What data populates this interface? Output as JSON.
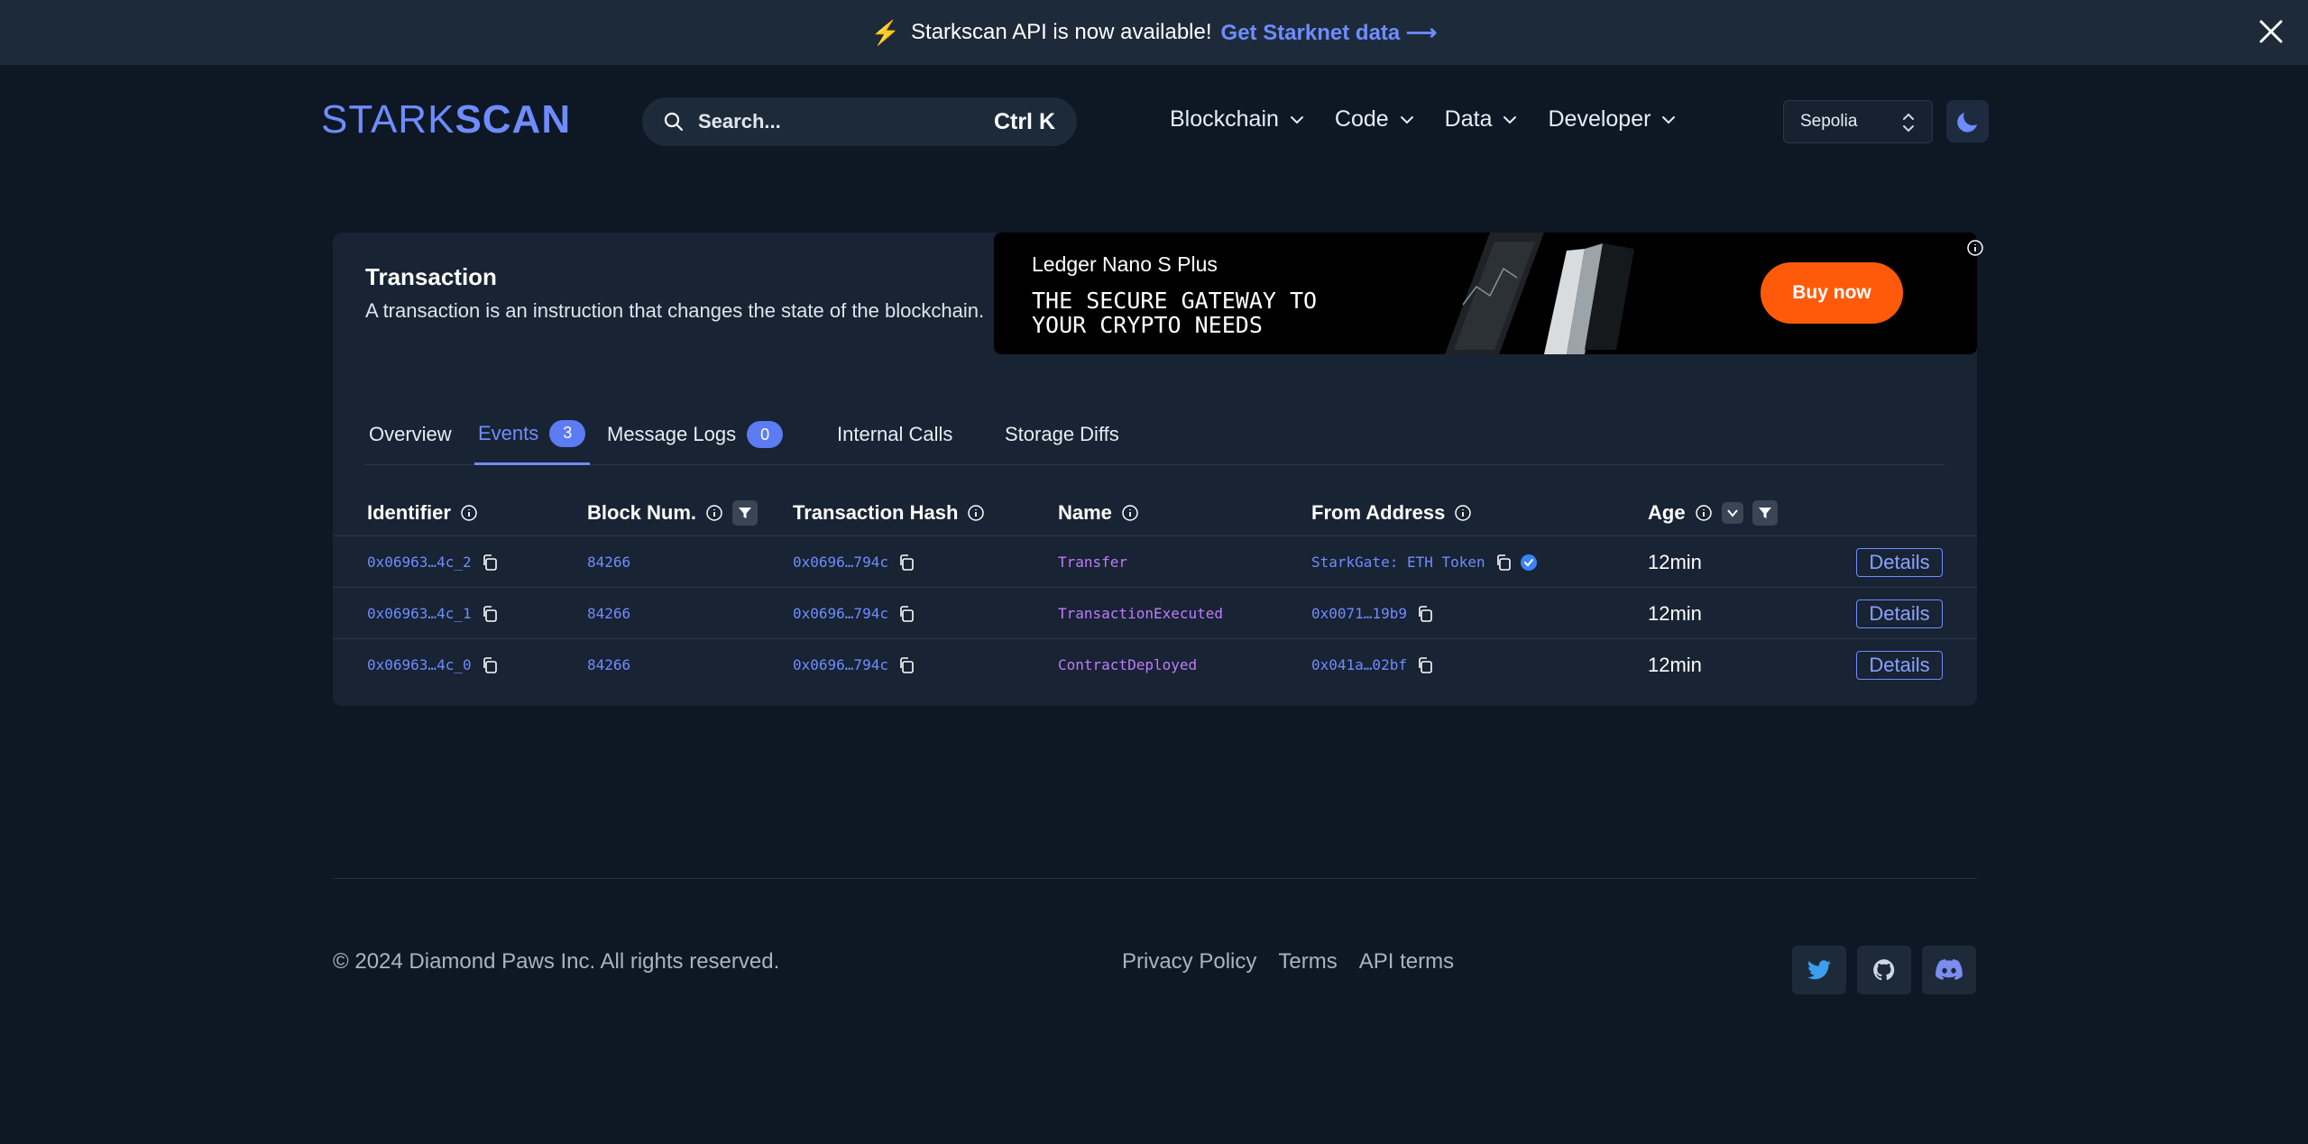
{
  "banner": {
    "text": "Starkscan API is now available!",
    "cta": "Get Starknet data ⟶"
  },
  "header": {
    "logo_light": "STARK",
    "logo_bold": "SCAN",
    "search_placeholder": "Search...",
    "search_shortcut": "Ctrl K",
    "nav": [
      "Blockchain",
      "Code",
      "Data",
      "Developer"
    ],
    "network": "Sepolia"
  },
  "card": {
    "title": "Transaction",
    "description": "A transaction is an instruction that changes the state of the blockchain."
  },
  "ad": {
    "product": "Ledger Nano S Plus",
    "tagline": "THE SECURE GATEWAY TO YOUR CRYPTO NEEDS",
    "button": "Buy now"
  },
  "tabs": [
    {
      "label": "Overview"
    },
    {
      "label": "Events",
      "count": "3"
    },
    {
      "label": "Message Logs",
      "count": "0"
    },
    {
      "label": "Internal Calls"
    },
    {
      "label": "Storage Diffs"
    }
  ],
  "table": {
    "headers": [
      "Identifier",
      "Block Num.",
      "Transaction Hash",
      "Name",
      "From Address",
      "Age"
    ],
    "details_label": "Details",
    "rows": [
      {
        "identifier": "0x06963…4c_2",
        "block": "84266",
        "tx_hash": "0x0696…794c",
        "name": "Transfer",
        "from": "StarkGate: ETH Token",
        "verified": true,
        "age": "12min"
      },
      {
        "identifier": "0x06963…4c_1",
        "block": "84266",
        "tx_hash": "0x0696…794c",
        "name": "TransactionExecuted",
        "from": "0x0071…19b9",
        "verified": false,
        "age": "12min"
      },
      {
        "identifier": "0x06963…4c_0",
        "block": "84266",
        "tx_hash": "0x0696…794c",
        "name": "ContractDeployed",
        "from": "0x041a…02bf",
        "verified": false,
        "age": "12min"
      }
    ]
  },
  "footer": {
    "copyright": "© 2024 Diamond Paws Inc. All rights reserved.",
    "links": [
      "Privacy Policy",
      "Terms",
      "API terms"
    ],
    "social": [
      "twitter-icon",
      "github-icon",
      "discord-icon"
    ]
  },
  "colors": {
    "accent": "#6f8cff",
    "event_name": "#c07bff",
    "banner_bolt": "#f97316",
    "ad_button": "#ff5a0a",
    "background": "#0e1724",
    "card": "#182333"
  }
}
